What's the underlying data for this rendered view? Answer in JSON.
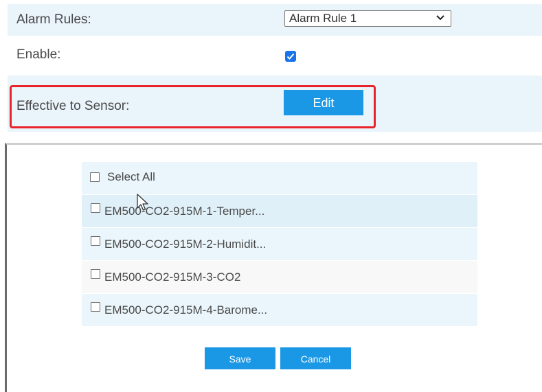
{
  "form": {
    "alarm_rules": {
      "label": "Alarm Rules:",
      "selected": "Alarm Rule 1"
    },
    "enable": {
      "label": "Enable:",
      "checked": true
    },
    "effective": {
      "label": "Effective to Sensor:",
      "edit_label": "Edit"
    }
  },
  "sensor_panel": {
    "select_all_label": "Select All",
    "sensors": [
      {
        "label": "EM500-CO2-915M-1-Temper...",
        "checked": false
      },
      {
        "label": "EM500-CO2-915M-2-Humidit...",
        "checked": false
      },
      {
        "label": "EM500-CO2-915M-3-CO2",
        "checked": false
      },
      {
        "label": "EM500-CO2-915M-4-Barome...",
        "checked": false
      }
    ],
    "save_label": "Save",
    "cancel_label": "Cancel"
  },
  "colors": {
    "accent": "#1a98e6",
    "highlight": "#e8232a",
    "row_bg": "#eaf4fb"
  },
  "icons": {
    "dropdown": "chevron-down-icon",
    "checkbox": "checkmark-icon",
    "cursor": "mouse-pointer-icon"
  }
}
